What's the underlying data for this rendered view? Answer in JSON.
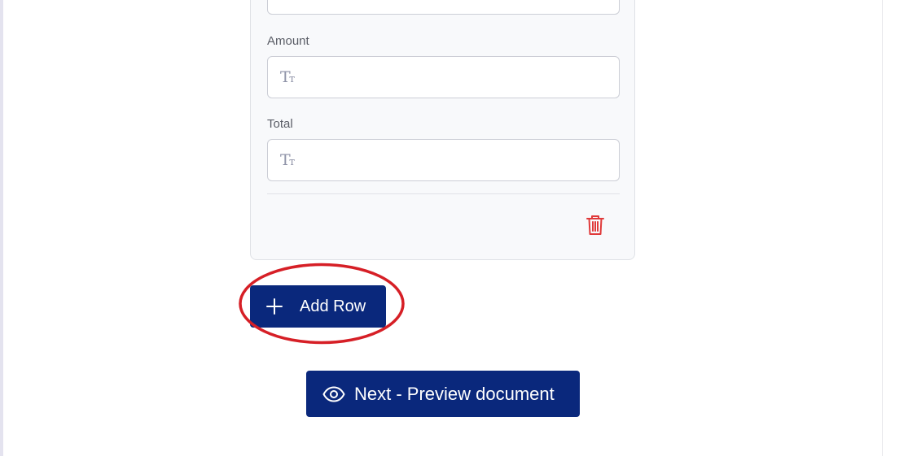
{
  "form": {
    "row_card": {
      "fields": [
        {
          "label": "",
          "value": "",
          "icon": "text-type-icon"
        },
        {
          "label": "Amount",
          "value": "",
          "icon": "text-type-icon"
        },
        {
          "label": "Total",
          "value": "",
          "icon": "text-type-icon"
        }
      ],
      "field_icon_text": "Tт",
      "delete_icon": "trash-icon"
    },
    "add_row_button": {
      "label": "Add Row",
      "icon": "plus-icon"
    },
    "preview_button": {
      "label": "Next - Preview document",
      "icon": "eye-icon"
    }
  },
  "colors": {
    "primary": "#0a287c",
    "danger": "#e03a3a",
    "annotation": "#d61f26",
    "card_bg": "#f8f9fb",
    "label": "#5a5d66"
  }
}
